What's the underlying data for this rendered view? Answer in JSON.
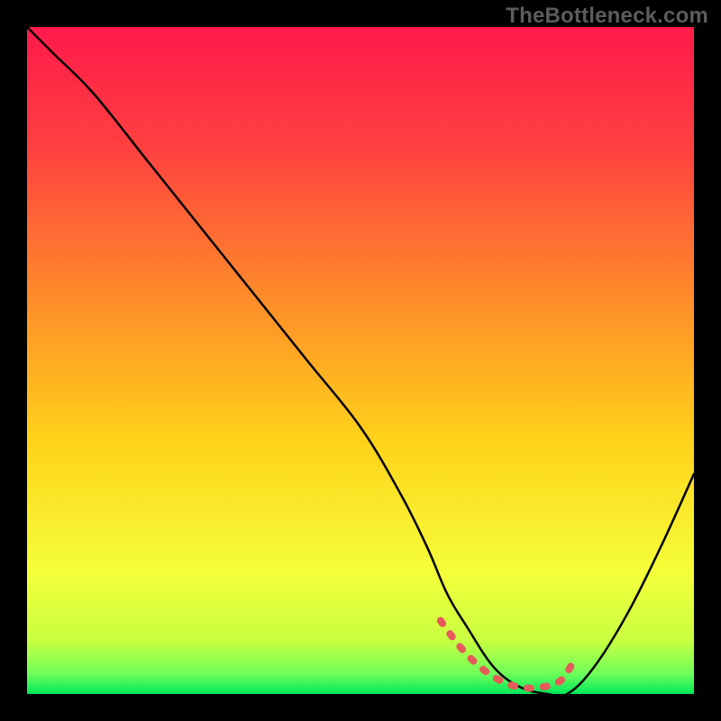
{
  "watermark": "TheBottleneck.com",
  "chart_data": {
    "type": "line",
    "title": "",
    "xlabel": "",
    "ylabel": "",
    "x_range": [
      0,
      100
    ],
    "y_range": [
      0,
      100
    ],
    "grid": false,
    "legend": false,
    "background_gradient": {
      "type": "vertical",
      "stops": [
        {
          "pos": 0.0,
          "color": "#ff1a4b"
        },
        {
          "pos": 0.18,
          "color": "#ff4040"
        },
        {
          "pos": 0.4,
          "color": "#ff8a2a"
        },
        {
          "pos": 0.62,
          "color": "#ffd21a"
        },
        {
          "pos": 0.82,
          "color": "#f5ff3a"
        },
        {
          "pos": 0.92,
          "color": "#c8ff40"
        },
        {
          "pos": 0.97,
          "color": "#6dff5a"
        },
        {
          "pos": 1.0,
          "color": "#00e85a"
        }
      ]
    },
    "series": [
      {
        "name": "bottleneck-curve",
        "color": "#000000",
        "x": [
          0,
          4,
          10,
          18,
          26,
          34,
          42,
          50,
          56,
          60,
          63,
          66,
          70,
          74,
          78,
          81,
          85,
          90,
          95,
          100
        ],
        "values": [
          100,
          96,
          90,
          80,
          70,
          60,
          50,
          40,
          30,
          22,
          15,
          10,
          4,
          1,
          0,
          0,
          4,
          12,
          22,
          33
        ]
      },
      {
        "name": "optimal-band",
        "color": "#e55a5a",
        "stroke_width": 8,
        "x": [
          62,
          65,
          68,
          71,
          74,
          77,
          80,
          82
        ],
        "values": [
          11,
          7,
          4,
          2,
          1,
          1,
          2,
          5
        ]
      }
    ]
  }
}
